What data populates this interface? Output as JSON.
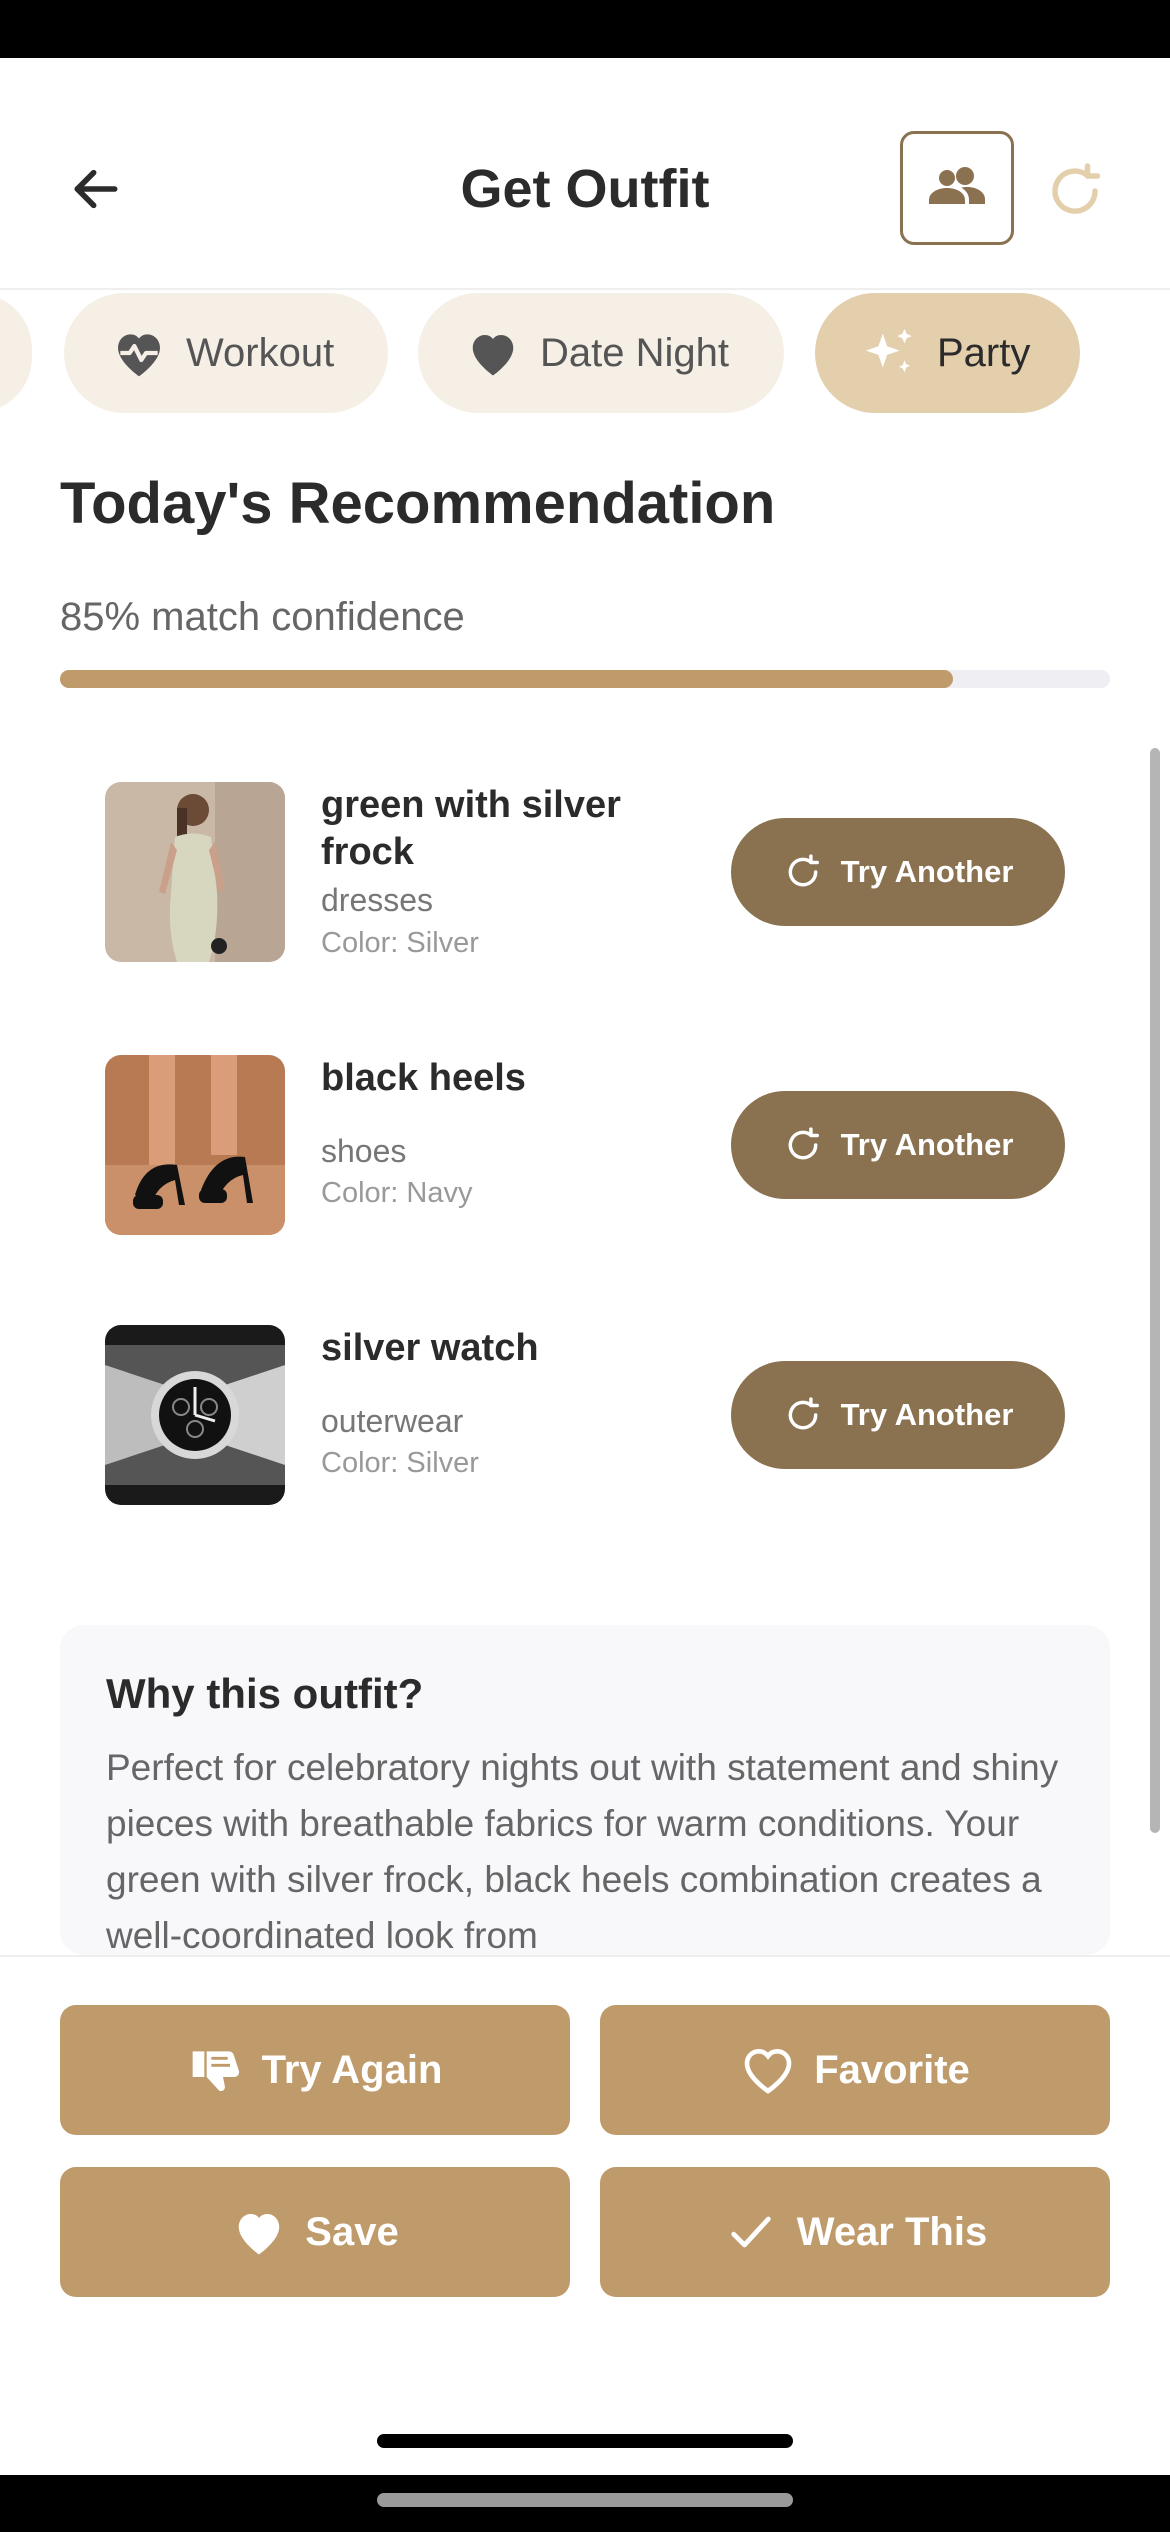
{
  "header": {
    "title": "Get Outfit",
    "back_icon": "arrow-left-icon",
    "people_icon": "people-icon",
    "refresh_icon": "refresh-icon"
  },
  "occasions": [
    {
      "label": "Workout",
      "icon": "heart-pulse-icon",
      "active": false
    },
    {
      "label": "Date Night",
      "icon": "heart-icon",
      "active": false
    },
    {
      "label": "Party",
      "icon": "sparkles-icon",
      "active": true
    }
  ],
  "recommendation": {
    "title": "Today's Recommendation",
    "confidence_text": "85% match confidence",
    "confidence_value": 0.85,
    "items": [
      {
        "name": "green with silver frock",
        "category": "dresses",
        "color": "Color: Silver",
        "button": "Try Another"
      },
      {
        "name": "black heels",
        "category": "shoes",
        "color": "Color: Navy",
        "button": "Try Another"
      },
      {
        "name": "silver watch",
        "category": "outerwear",
        "color": "Color: Silver",
        "button": "Try Another"
      }
    ]
  },
  "why": {
    "title": "Why this outfit?",
    "text": "Perfect for celebratory nights out with statement and shiny pieces with breathable fabrics for warm conditions. Your green with silver frock, black heels combination creates a well-coordinated look from"
  },
  "actions": {
    "try_again": "Try Again",
    "favorite": "Favorite",
    "save": "Save",
    "wear_this": "Wear This"
  },
  "colors": {
    "accent": "#bf9a6a",
    "accent_dark": "#8a7150",
    "chip_bg": "#f5efe6",
    "chip_active": "#e4cfad"
  }
}
